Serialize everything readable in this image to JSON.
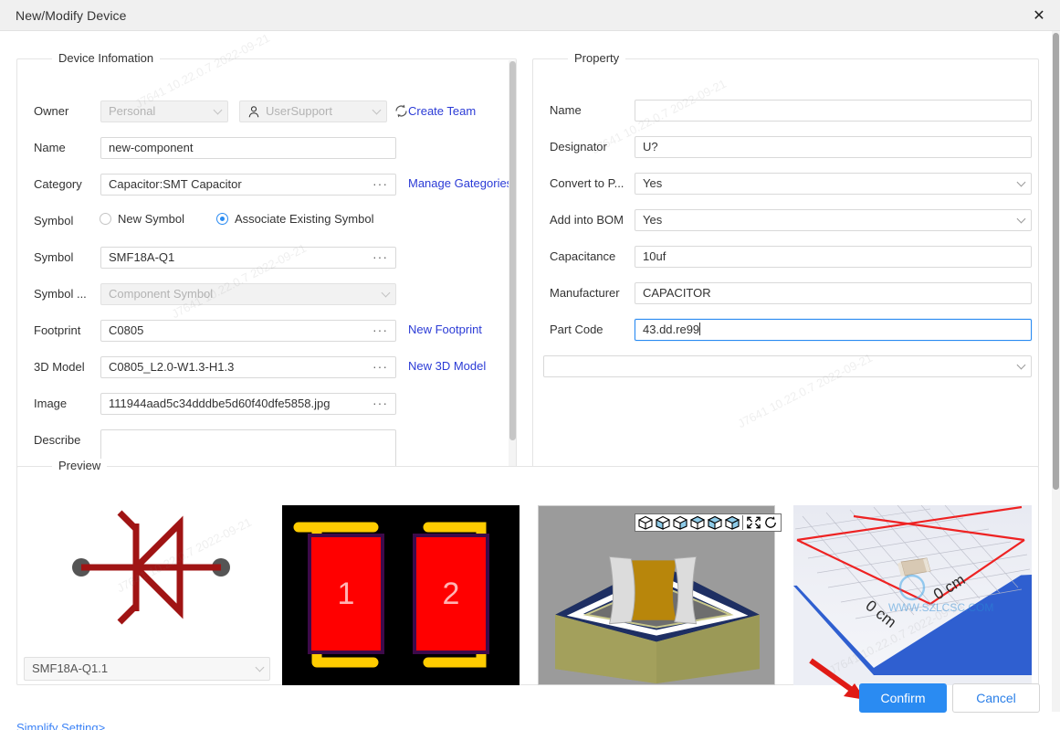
{
  "window": {
    "title": "New/Modify Device",
    "close_icon": "close-icon"
  },
  "device_information": {
    "legend": "Device Infomation",
    "fields": {
      "owner": {
        "label": "Owner",
        "scope_value": "Personal",
        "scope_disabled": true,
        "team_value": "UserSupport",
        "team_disabled": true,
        "team_icon": "user-icon",
        "refresh_icon": "refresh-icon",
        "create_team_link": "Create Team"
      },
      "name": {
        "label": "Name",
        "value": "new-component"
      },
      "category": {
        "label": "Category",
        "value": "Capacitor:SMT Capacitor",
        "browse_icon": "ellipsis-icon",
        "link": "Manage Gategories"
      },
      "symbol_mode": {
        "label": "Symbol",
        "options": [
          "New Symbol",
          "Associate Existing Symbol"
        ],
        "selected": "Associate Existing Symbol"
      },
      "symbol": {
        "label": "Symbol",
        "value": "SMF18A-Q1",
        "browse_icon": "ellipsis-icon"
      },
      "symbol_type": {
        "label": "Symbol ...",
        "value": "Component Symbol",
        "disabled": true
      },
      "footprint": {
        "label": "Footprint",
        "value": "C0805",
        "browse_icon": "ellipsis-icon",
        "link": "New Footprint"
      },
      "model3d": {
        "label": "3D Model",
        "value": "C0805_L2.0-W1.3-H1.3",
        "browse_icon": "ellipsis-icon",
        "link": "New 3D Model"
      },
      "image": {
        "label": "Image",
        "value": "111944aad5c34dddbe5d60f40dfe5858.jpg",
        "browse_icon": "ellipsis-icon"
      },
      "describe": {
        "label": "Describe",
        "value": ""
      }
    }
  },
  "property": {
    "legend": "Property",
    "fields": [
      {
        "label": "Name",
        "value": "",
        "type": "text"
      },
      {
        "label": "Designator",
        "value": "U?",
        "type": "text"
      },
      {
        "label": "Convert to P...",
        "value": "Yes",
        "type": "select"
      },
      {
        "label": "Add into BOM",
        "value": "Yes",
        "type": "select"
      },
      {
        "label": "Capacitance",
        "value": "10uf",
        "type": "text"
      },
      {
        "label": "Manufacturer",
        "value": "CAPACITOR",
        "type": "text"
      },
      {
        "label": "Part Code",
        "value": "43.dd.re99",
        "type": "text",
        "focused": true
      },
      {
        "label": "",
        "value": "",
        "type": "select"
      }
    ]
  },
  "preview": {
    "legend": "Preview",
    "symbol_selector_value": "SMF18A-Q1.1",
    "footprint_pads": [
      "1",
      "2"
    ],
    "viewer_toolbar": {
      "cube_icons": [
        "cube-view-1-icon",
        "cube-view-2-icon",
        "cube-view-3-icon",
        "cube-view-4-icon",
        "cube-view-5-icon",
        "cube-view-6-icon"
      ],
      "fit_icon": "fit-to-screen-icon",
      "rotate_icon": "rotate-icon"
    },
    "product_image_labels": [
      "0 cm",
      "0 cm"
    ]
  },
  "footer": {
    "simplify_link": "Simplify Setting>",
    "confirm_label": "Confirm",
    "cancel_label": "Cancel",
    "annotation_arrow": "red-arrow-pointing-to-confirm"
  },
  "colors": {
    "accent_blue": "#2a8bf2",
    "link_blue": "#2b3bd6",
    "symbol_red": "#a01414",
    "pad_red": "#ff0000",
    "silk_yellow": "#ffcc00",
    "arrow_red": "#e01b16"
  },
  "watermarks": [
    "J7641  10.22.0.7  2022-09-21"
  ]
}
